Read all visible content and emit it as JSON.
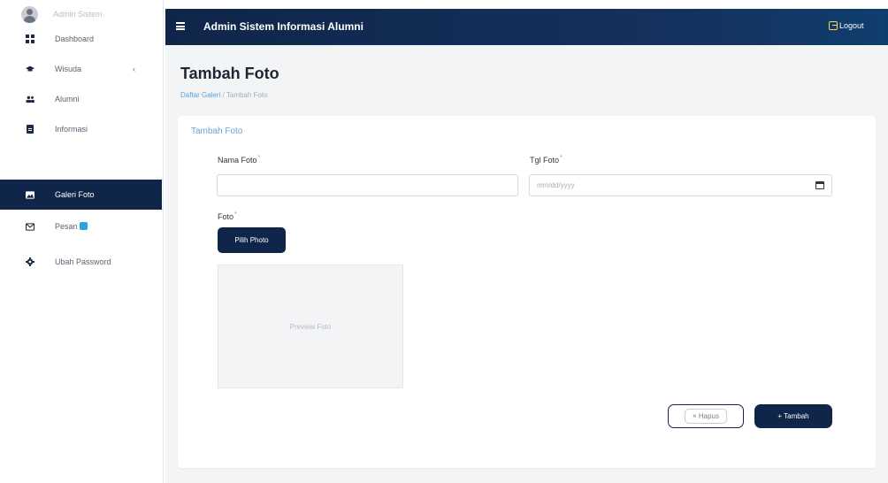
{
  "sidebar": {
    "profile_name": "Admin Sistem",
    "items": [
      {
        "label": "Dashboard",
        "icon": "grid-icon"
      },
      {
        "label": "Wisuda",
        "icon": "graduation-cap-icon",
        "caret": "‹"
      },
      {
        "label": "Alumni",
        "icon": "users-icon"
      },
      {
        "label": "Informasi",
        "icon": "document-icon"
      },
      {
        "label": "Galeri Foto",
        "icon": "image-icon"
      },
      {
        "label": "Pesan",
        "icon": "mail-icon",
        "badge": true
      },
      {
        "label": "Ubah Password",
        "icon": "gear-icon"
      }
    ],
    "active_item": "Galeri Foto"
  },
  "header": {
    "menu_icon": "≡",
    "title": "Admin Sistem Informasi Alumni",
    "logout_label": "Logout"
  },
  "page": {
    "title": "Tambah Foto",
    "breadcrumb": {
      "link": "Daftar Galeri",
      "separator": " / ",
      "current": "Tambah Foto"
    }
  },
  "form": {
    "card_title": "Tambah Foto",
    "nama_foto_label": "Nama Foto",
    "nama_foto_value": "",
    "tgl_foto_label": "Tgl Foto",
    "tgl_foto_placeholder": "mm/dd/yyyy",
    "foto_label": "Foto",
    "required_mark": "*",
    "pilih_photo_label": "Pilih Photo",
    "preview_text": "Preview Foto",
    "hapus_label": "× Hapus",
    "tambah_label": "+ Tambah"
  },
  "colors": {
    "primary": "#10254a",
    "accent": "#2ba3e0",
    "logout_icon": "#ffd23f",
    "link": "#5d9fd6"
  }
}
